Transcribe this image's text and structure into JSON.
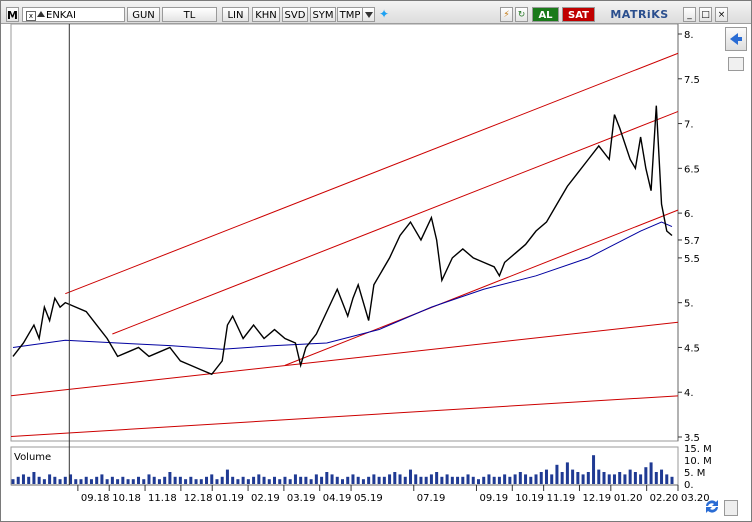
{
  "toolbar": {
    "menu": "M",
    "symbol": "ENKAI",
    "periods": [
      "GUN",
      "TL",
      "LIN",
      "KHN",
      "SVD",
      "SYM",
      "TMP"
    ],
    "al": "AL",
    "sat": "SAT",
    "brand": "MATRiKS"
  },
  "colors": {
    "price": "#000000",
    "moving_average": "#0000a0",
    "trend_lines": "#cc0000",
    "volume": "#1f3a93",
    "buy": "#1a7a1a",
    "sell": "#c00000"
  },
  "chart_data": {
    "type": "line",
    "price_ticks": [
      "8.",
      "7.5",
      "7.",
      "6.5",
      "6.",
      "5.7",
      "5.5",
      "5.",
      "4.5",
      "4.",
      "3.5"
    ],
    "x_ticks": [
      "09.18",
      "10.18",
      "11.18",
      "12.18",
      "01.19",
      "02.19",
      "03.19",
      "04.19",
      "05.19",
      "07.19",
      "09.19",
      "10.19",
      "11.19",
      "12.19",
      "01.20",
      "02.20",
      "03.20"
    ],
    "volume_label": "Volume",
    "volume_ticks": [
      "15. M",
      "10. M",
      "5. M",
      "0."
    ],
    "ylim": [
      3.5,
      8.0
    ],
    "price_series": [
      [
        0,
        4.4
      ],
      [
        2,
        4.55
      ],
      [
        4,
        4.75
      ],
      [
        5,
        4.6
      ],
      [
        6,
        4.95
      ],
      [
        7,
        4.8
      ],
      [
        8,
        5.05
      ],
      [
        9,
        4.95
      ],
      [
        10,
        5.0
      ],
      [
        12,
        4.95
      ],
      [
        14,
        4.9
      ],
      [
        16,
        4.75
      ],
      [
        18,
        4.6
      ],
      [
        20,
        4.4
      ],
      [
        22,
        4.45
      ],
      [
        24,
        4.5
      ],
      [
        26,
        4.4
      ],
      [
        28,
        4.45
      ],
      [
        30,
        4.5
      ],
      [
        32,
        4.35
      ],
      [
        34,
        4.3
      ],
      [
        36,
        4.25
      ],
      [
        38,
        4.2
      ],
      [
        40,
        4.35
      ],
      [
        41,
        4.75
      ],
      [
        42,
        4.85
      ],
      [
        44,
        4.6
      ],
      [
        46,
        4.75
      ],
      [
        48,
        4.6
      ],
      [
        50,
        4.7
      ],
      [
        52,
        4.6
      ],
      [
        54,
        4.55
      ],
      [
        55,
        4.3
      ],
      [
        56,
        4.5
      ],
      [
        58,
        4.65
      ],
      [
        60,
        4.9
      ],
      [
        62,
        5.15
      ],
      [
        63,
        5.0
      ],
      [
        64,
        4.85
      ],
      [
        65,
        5.05
      ],
      [
        66,
        5.2
      ],
      [
        67,
        5.0
      ],
      [
        68,
        4.8
      ],
      [
        69,
        5.2
      ],
      [
        70,
        5.3
      ],
      [
        72,
        5.5
      ],
      [
        74,
        5.75
      ],
      [
        76,
        5.9
      ],
      [
        78,
        5.7
      ],
      [
        80,
        5.95
      ],
      [
        81,
        5.7
      ],
      [
        82,
        5.25
      ],
      [
        84,
        5.5
      ],
      [
        86,
        5.6
      ],
      [
        88,
        5.5
      ],
      [
        90,
        5.45
      ],
      [
        92,
        5.4
      ],
      [
        93,
        5.3
      ],
      [
        94,
        5.45
      ],
      [
        96,
        5.55
      ],
      [
        98,
        5.65
      ],
      [
        100,
        5.8
      ],
      [
        102,
        5.9
      ],
      [
        104,
        6.1
      ],
      [
        106,
        6.3
      ],
      [
        108,
        6.45
      ],
      [
        110,
        6.6
      ],
      [
        112,
        6.75
      ],
      [
        114,
        6.6
      ],
      [
        115,
        7.1
      ],
      [
        116,
        6.95
      ],
      [
        118,
        6.6
      ],
      [
        119,
        6.5
      ],
      [
        120,
        6.85
      ],
      [
        121,
        6.5
      ],
      [
        122,
        6.25
      ],
      [
        123,
        7.2
      ],
      [
        124,
        6.1
      ],
      [
        125,
        5.8
      ],
      [
        126,
        5.75
      ]
    ],
    "moving_average": [
      [
        0,
        4.5
      ],
      [
        10,
        4.58
      ],
      [
        20,
        4.55
      ],
      [
        30,
        4.52
      ],
      [
        40,
        4.48
      ],
      [
        50,
        4.52
      ],
      [
        60,
        4.55
      ],
      [
        70,
        4.7
      ],
      [
        80,
        4.95
      ],
      [
        90,
        5.15
      ],
      [
        100,
        5.3
      ],
      [
        110,
        5.5
      ],
      [
        115,
        5.65
      ],
      [
        120,
        5.8
      ],
      [
        124,
        5.9
      ],
      [
        126,
        5.85
      ]
    ],
    "trend_lines": [
      {
        "name": "upper",
        "from": [
          10,
          5.1
        ],
        "to": [
          130,
          7.85
        ]
      },
      {
        "name": "middle",
        "from": [
          19,
          4.65
        ],
        "to": [
          130,
          7.2
        ]
      },
      {
        "name": "lower",
        "from": [
          52,
          4.3
        ],
        "to": [
          130,
          6.1
        ]
      },
      {
        "name": "base-high",
        "from": [
          -2,
          3.95
        ],
        "to": [
          130,
          4.8
        ]
      },
      {
        "name": "base-low",
        "from": [
          -2,
          3.5
        ],
        "to": [
          130,
          3.97
        ]
      }
    ],
    "volume_series": [
      2,
      3,
      4,
      3,
      5,
      3,
      2,
      4,
      3,
      2,
      3,
      4,
      2,
      2,
      3,
      2,
      3,
      4,
      2,
      3,
      2,
      3,
      2,
      2,
      3,
      2,
      4,
      3,
      2,
      3,
      5,
      3,
      3,
      2,
      3,
      2,
      2,
      3,
      4,
      2,
      3,
      6,
      3,
      2,
      3,
      2,
      3,
      4,
      3,
      2,
      3,
      2,
      3,
      2,
      4,
      3,
      3,
      2,
      4,
      3,
      5,
      4,
      3,
      2,
      3,
      4,
      3,
      2,
      3,
      4,
      3,
      3,
      4,
      5,
      4,
      3,
      6,
      4,
      3,
      3,
      4,
      5,
      3,
      4,
      3,
      3,
      3,
      4,
      3,
      2,
      3,
      4,
      3,
      3,
      4,
      3,
      4,
      5,
      4,
      3,
      4,
      5,
      6,
      4,
      8,
      5,
      9,
      6,
      5,
      4,
      5,
      12,
      6,
      5,
      4,
      4,
      5,
      4,
      6,
      5,
      4,
      7,
      9,
      5,
      6,
      4,
      3
    ],
    "crosshair_x": 10
  }
}
